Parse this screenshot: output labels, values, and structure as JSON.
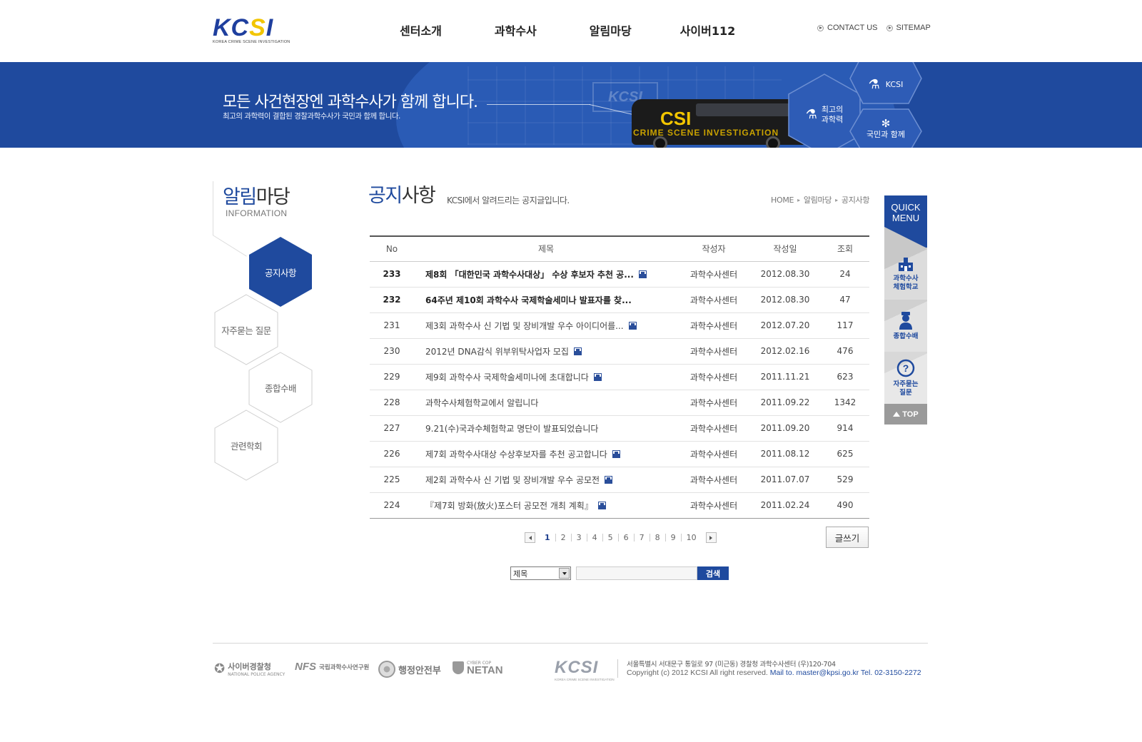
{
  "header": {
    "logo_text": "KCSI",
    "logo_sub": "KOREA CRIME SCENE INVESTIGATION",
    "nav": [
      "센터소개",
      "과학수사",
      "알림마당",
      "사이버112"
    ],
    "util": [
      "CONTACT US",
      "SITEMAP"
    ]
  },
  "banner": {
    "headline": "모든 사건현장엔 과학수사가 함께 합니다.",
    "subline": "최고의 과학력이 결합된 경찰과학수사가 국민과 함께 합니다.",
    "bus_text": "CSI",
    "bus_subtext": "CRIME SCENE INVESTIGATION",
    "ghost_logo": "KCSI",
    "hex_kcsi": "KCSI",
    "hex_science": [
      "최고의",
      "과학력"
    ],
    "hex_people": "국민과 함께"
  },
  "sidebar": {
    "title_accent": "알림",
    "title_rest": "마당",
    "title_en": "INFORMATION",
    "menu": [
      "공지사항",
      "자주묻는 질문",
      "종합수배",
      "관련학회"
    ]
  },
  "content": {
    "title_accent": "공지",
    "title_rest": "사항",
    "desc": "KCSI에서 알려드리는 공지글입니다.",
    "breadcrumb": [
      "HOME",
      "알림마당",
      "공지사항"
    ],
    "columns": [
      "No",
      "제목",
      "작성자",
      "작성일",
      "조회"
    ],
    "rows": [
      {
        "no": "233",
        "subject": "제8회 「대한민국 과학수사대상」 수상 후보자 추천 공...",
        "author": "과학수사센터",
        "date": "2012.08.30",
        "views": "24",
        "notice": true,
        "file": true
      },
      {
        "no": "232",
        "subject": "64주년 제10회 과학수사 국제학술세미나 발표자를 찾...",
        "author": "과학수사센터",
        "date": "2012.08.30",
        "views": "47",
        "notice": true,
        "file": false
      },
      {
        "no": "231",
        "subject": "제3회 과학수사 신 기법 및 장비개발 우수 아이디어를...",
        "author": "과학수사센터",
        "date": "2012.07.20",
        "views": "117",
        "notice": false,
        "file": true
      },
      {
        "no": "230",
        "subject": "2012년 DNA감식 위부위탁사업자 모집",
        "author": "과학수사센터",
        "date": "2012.02.16",
        "views": "476",
        "notice": false,
        "file": true
      },
      {
        "no": "229",
        "subject": "제9회 과학수사 국제학술세미나에 초대합니다",
        "author": "과학수사센터",
        "date": "2011.11.21",
        "views": "623",
        "notice": false,
        "file": true
      },
      {
        "no": "228",
        "subject": "과학수사체험학교에서 알립니다",
        "author": "과학수사센터",
        "date": "2011.09.22",
        "views": "1342",
        "notice": false,
        "file": false
      },
      {
        "no": "227",
        "subject": "9.21(수)국과수체험학교 명단이 발표되었습니다",
        "author": "과학수사센터",
        "date": "2011.09.20",
        "views": "914",
        "notice": false,
        "file": false
      },
      {
        "no": "226",
        "subject": "제7회 과학수사대상 수상후보자를 추천 공고합니다",
        "author": "과학수사센터",
        "date": "2011.08.12",
        "views": "625",
        "notice": false,
        "file": true
      },
      {
        "no": "225",
        "subject": "제2회 과학수사 신 기법 및 장비개발 우수 공모전",
        "author": "과학수사센터",
        "date": "2011.07.07",
        "views": "529",
        "notice": false,
        "file": true
      },
      {
        "no": "224",
        "subject": "『제7회 방화(放火)포스터 공모전 개최 계획』",
        "author": "과학수사센터",
        "date": "2011.02.24",
        "views": "490",
        "notice": false,
        "file": true
      }
    ],
    "pages": [
      "1",
      "2",
      "3",
      "4",
      "5",
      "6",
      "7",
      "8",
      "9",
      "10"
    ],
    "current_page": "1",
    "write_label": "글쓰기",
    "search": {
      "select_value": "제목",
      "keyword": "",
      "button": "검색"
    }
  },
  "quick": {
    "title": [
      "QUICK",
      "MENU"
    ],
    "items": [
      {
        "line1": "과학수사",
        "line2": "체험학교",
        "icon": "school-icon"
      },
      {
        "line1": "종합수배",
        "line2": "",
        "icon": "police-officer-icon"
      },
      {
        "line1": "자주묻는",
        "line2": "질문",
        "icon": "question-icon"
      }
    ],
    "top": "TOP"
  },
  "footer": {
    "logos": [
      {
        "name": "사이버경찰청",
        "sub": "NATIONAL POLICE AGENCY"
      },
      {
        "name": "국립과학수사연구원",
        "sub": "NFS"
      },
      {
        "name": "행정안전부",
        "sub": ""
      },
      {
        "name": "NETAN",
        "sub": "CYBER COP"
      }
    ],
    "kcsi": "KCSI",
    "kcsi_sub": "KOREA CRIME SCENE INVESTIGATION",
    "address": "서울특별시 서대문구 통일로 97 (미근동) 경찰청 과학수사센터 (우)120-704",
    "copyright": "Copyright (c) 2012 KCSI All right reserved.",
    "mail": "Mail to. master@kpsi.go.kr Tel. 02-3150-2272"
  },
  "colors": {
    "brand_blue": "#1f4a9e",
    "logo_yellow": "#f2c500"
  }
}
